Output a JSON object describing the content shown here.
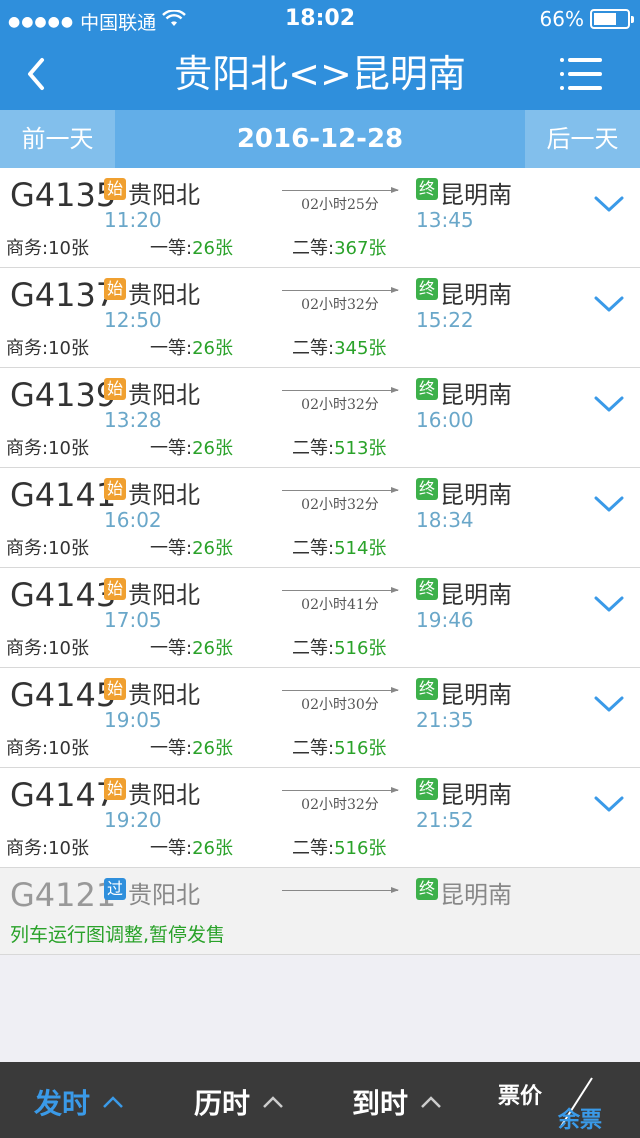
{
  "status_bar": {
    "signal": "●●●●●",
    "carrier": "中国联通",
    "time": "18:02",
    "battery": "66%"
  },
  "nav": {
    "title": "贵阳北<>昆明南"
  },
  "date_bar": {
    "prev_label": "前一天",
    "date": "2016-12-28",
    "next_label": "后一天"
  },
  "trains": [
    {
      "no": "G4135",
      "start_badge": "始",
      "from": "贵阳北",
      "dep": "11:20",
      "duration": "02小时25分",
      "end_badge": "终",
      "to": "昆明南",
      "arr": "13:45",
      "seat1_label": "商务:",
      "seat1_count": "10张",
      "seat2_label": "一等:",
      "seat2_count": "26张",
      "seat3_label": "二等:",
      "seat3_count": "367张"
    },
    {
      "no": "G4137",
      "start_badge": "始",
      "from": "贵阳北",
      "dep": "12:50",
      "duration": "02小时32分",
      "end_badge": "终",
      "to": "昆明南",
      "arr": "15:22",
      "seat1_label": "商务:",
      "seat1_count": "10张",
      "seat2_label": "一等:",
      "seat2_count": "26张",
      "seat3_label": "二等:",
      "seat3_count": "345张"
    },
    {
      "no": "G4139",
      "start_badge": "始",
      "from": "贵阳北",
      "dep": "13:28",
      "duration": "02小时32分",
      "end_badge": "终",
      "to": "昆明南",
      "arr": "16:00",
      "seat1_label": "商务:",
      "seat1_count": "10张",
      "seat2_label": "一等:",
      "seat2_count": "26张",
      "seat3_label": "二等:",
      "seat3_count": "513张"
    },
    {
      "no": "G4141",
      "start_badge": "始",
      "from": "贵阳北",
      "dep": "16:02",
      "duration": "02小时32分",
      "end_badge": "终",
      "to": "昆明南",
      "arr": "18:34",
      "seat1_label": "商务:",
      "seat1_count": "10张",
      "seat2_label": "一等:",
      "seat2_count": "26张",
      "seat3_label": "二等:",
      "seat3_count": "514张"
    },
    {
      "no": "G4143",
      "start_badge": "始",
      "from": "贵阳北",
      "dep": "17:05",
      "duration": "02小时41分",
      "end_badge": "终",
      "to": "昆明南",
      "arr": "19:46",
      "seat1_label": "商务:",
      "seat1_count": "10张",
      "seat2_label": "一等:",
      "seat2_count": "26张",
      "seat3_label": "二等:",
      "seat3_count": "516张"
    },
    {
      "no": "G4145",
      "start_badge": "始",
      "from": "贵阳北",
      "dep": "19:05",
      "duration": "02小时30分",
      "end_badge": "终",
      "to": "昆明南",
      "arr": "21:35",
      "seat1_label": "商务:",
      "seat1_count": "10张",
      "seat2_label": "一等:",
      "seat2_count": "26张",
      "seat3_label": "二等:",
      "seat3_count": "516张"
    },
    {
      "no": "G4147",
      "start_badge": "始",
      "from": "贵阳北",
      "dep": "19:20",
      "duration": "02小时32分",
      "end_badge": "终",
      "to": "昆明南",
      "arr": "21:52",
      "seat1_label": "商务:",
      "seat1_count": "10张",
      "seat2_label": "一等:",
      "seat2_count": "26张",
      "seat3_label": "二等:",
      "seat3_count": "516张"
    }
  ],
  "suspended_train": {
    "no": "G4121",
    "pass_badge": "过",
    "from": "贵阳北",
    "end_badge": "终",
    "to": "昆明南",
    "notice": "列车运行图调整,暂停发售"
  },
  "bottom_tabs": {
    "depart": "发时",
    "duration": "历时",
    "arrive": "到时",
    "price": "票价",
    "remain": "余票"
  },
  "colors": {
    "header_blue": "#2f8fdc",
    "date_bar": "#62aee8",
    "ticket_green": "#2aa22a",
    "time_blue": "#6aa7c9",
    "badge_start": "#f0a030",
    "badge_end": "#3db04a",
    "badge_pass": "#2f8fdc",
    "bottom_bar": "#3a3a3a",
    "active_tab": "#3a9ae8"
  }
}
